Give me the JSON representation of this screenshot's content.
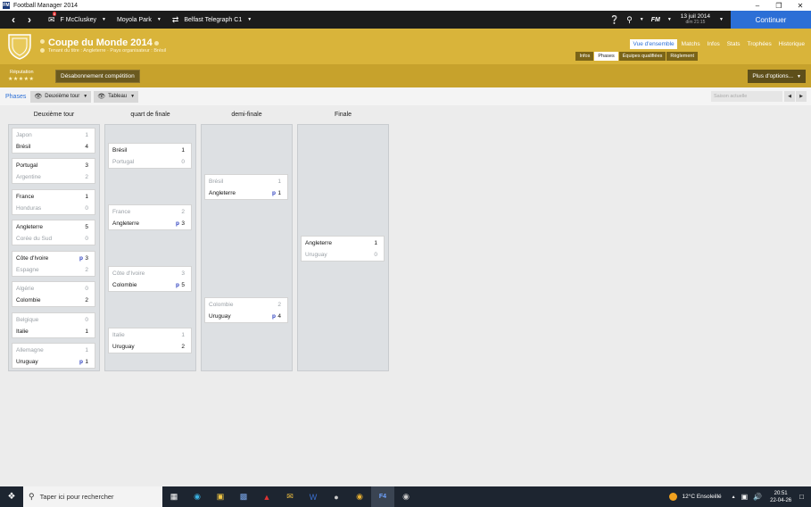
{
  "window": {
    "title": "Football Manager 2014",
    "app_icon": "FM",
    "controls": [
      "–",
      "❐",
      "✕"
    ]
  },
  "nav": {
    "manager": "F McCluskey",
    "club": "Moyola Park",
    "other_club": "Belfast Telegraph C1",
    "fm_label": "FM",
    "date": "13 juil 2014",
    "time": "dim 21:15",
    "continue_label": "Continuer",
    "mail_badge": "6"
  },
  "header": {
    "title": "Coupe du Monde 2014",
    "subtitle": "Tenant du titre : Angleterre · Pays organisateur : Brésil",
    "tabs": [
      {
        "label": "Vue d'ensemble",
        "active": true
      },
      {
        "label": "Matchs",
        "active": false
      },
      {
        "label": "Infos",
        "active": false
      },
      {
        "label": "Stats",
        "active": false
      },
      {
        "label": "Trophées",
        "active": false
      },
      {
        "label": "Historique",
        "active": false
      }
    ],
    "subtabs": [
      {
        "label": "Infos",
        "active": false
      },
      {
        "label": "Phases",
        "active": true
      },
      {
        "label": "Équipes qualifiées",
        "active": false
      },
      {
        "label": "Règlement",
        "active": false
      }
    ]
  },
  "subbar": {
    "reputation_label": "Réputation",
    "stars": "★★★★★",
    "unsubscribe_label": "Désabonnement compétition",
    "more_label": "Plus d'options..."
  },
  "phasebar": {
    "label": "Phases",
    "stage_dropdown": "Deuxième tour",
    "view_dropdown": "Tableau",
    "season_placeholder": "Saison actuelle"
  },
  "bracket": {
    "rounds": [
      {
        "name": "Deuxième tour",
        "matches": [
          {
            "home": "Japon",
            "home_score": "1",
            "away": "Brésil",
            "away_score": "4",
            "winner": 2
          },
          {
            "home": "Portugal",
            "home_score": "3",
            "away": "Argentine",
            "away_score": "2",
            "winner": 1
          },
          {
            "home": "France",
            "home_score": "1",
            "away": "Honduras",
            "away_score": "0",
            "winner": 1
          },
          {
            "home": "Angleterre",
            "home_score": "5",
            "away": "Corée du Sud",
            "away_score": "0",
            "winner": 1
          },
          {
            "home": "Côte d'Ivoire",
            "home_score": "3",
            "home_pen": "p",
            "away": "Espagne",
            "away_score": "2",
            "winner": 1
          },
          {
            "home": "Algérie",
            "home_score": "0",
            "away": "Colombie",
            "away_score": "2",
            "winner": 2
          },
          {
            "home": "Belgique",
            "home_score": "0",
            "away": "Italie",
            "away_score": "1",
            "winner": 2
          },
          {
            "home": "Allemagne",
            "home_score": "1",
            "away": "Uruguay",
            "away_score": "1",
            "away_pen": "p",
            "winner": 2
          }
        ]
      },
      {
        "name": "quart de finale",
        "matches": [
          {
            "home": "Brésil",
            "home_score": "1",
            "away": "Portugal",
            "away_score": "0",
            "winner": 1
          },
          {
            "home": "France",
            "home_score": "2",
            "away": "Angleterre",
            "away_score": "3",
            "away_pen": "p",
            "winner": 2
          },
          {
            "home": "Côte d'Ivoire",
            "home_score": "3",
            "away": "Colombie",
            "away_score": "5",
            "away_pen": "p",
            "winner": 2
          },
          {
            "home": "Italie",
            "home_score": "1",
            "away": "Uruguay",
            "away_score": "2",
            "winner": 2
          }
        ]
      },
      {
        "name": "demi-finale",
        "matches": [
          {
            "home": "Brésil",
            "home_score": "1",
            "away": "Angleterre",
            "away_score": "1",
            "away_pen": "p",
            "winner": 2
          },
          {
            "home": "Colombie",
            "home_score": "2",
            "away": "Uruguay",
            "away_score": "4",
            "away_pen": "p",
            "winner": 2
          }
        ]
      },
      {
        "name": "Finale",
        "matches": [
          {
            "home": "Angleterre",
            "home_score": "1",
            "away": "Uruguay",
            "away_score": "0",
            "winner": 1
          }
        ]
      }
    ]
  },
  "taskbar": {
    "search_placeholder": "Taper ici pour rechercher",
    "weather": "12°C  Ensoleillé",
    "time": "20:51",
    "date": "22-04-26"
  }
}
